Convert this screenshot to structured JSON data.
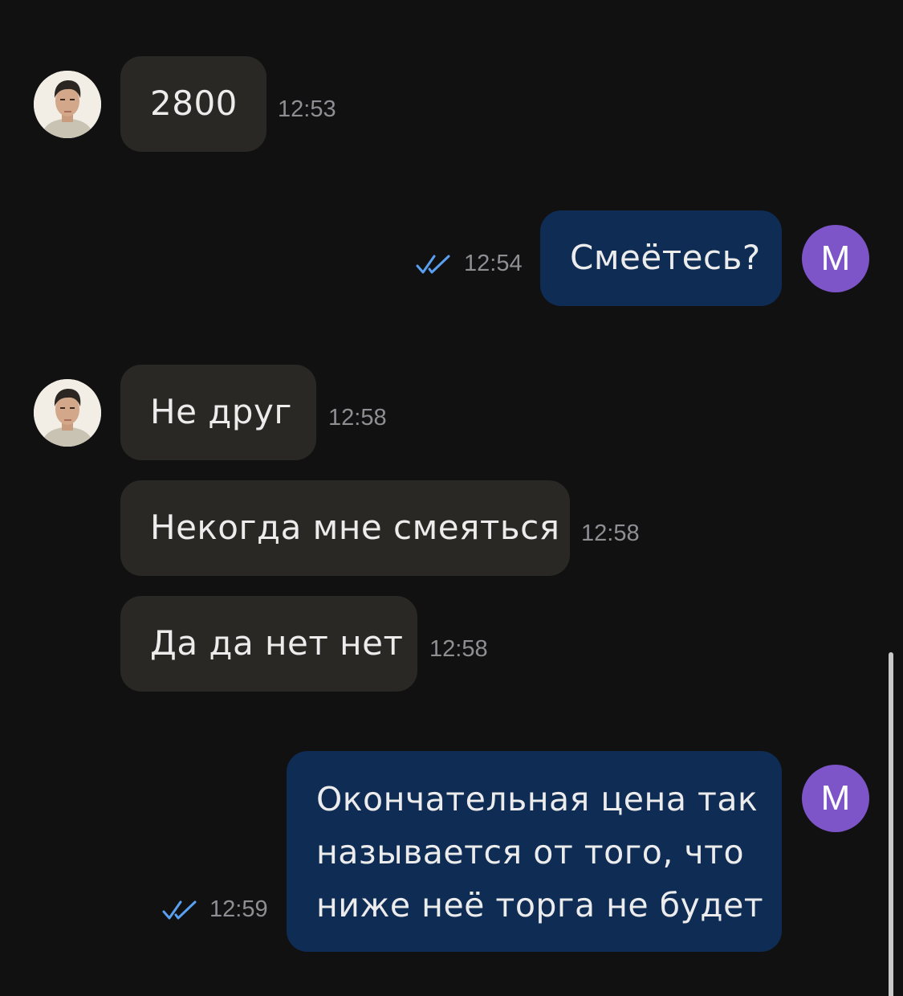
{
  "colors": {
    "background": "#111112",
    "incoming_bubble": "#2a2824",
    "outgoing_bubble": "#0f2c55",
    "read_check": "#5aa0f0",
    "own_avatar": "#7e55c8",
    "timestamp": "#8e8e93"
  },
  "contact": {
    "avatar_icon": "user-photo-avatar"
  },
  "me": {
    "avatar_letter": "M"
  },
  "messages": [
    {
      "direction": "incoming",
      "text": "2800",
      "time": "12:53"
    },
    {
      "direction": "outgoing",
      "text": "Смеётесь?",
      "time": "12:54",
      "status": "read"
    },
    {
      "direction": "incoming",
      "text": "Не друг",
      "time": "12:58"
    },
    {
      "direction": "incoming",
      "text": "Некогда мне смеяться",
      "time": "12:58"
    },
    {
      "direction": "incoming",
      "text": "Да да нет нет",
      "time": "12:58"
    },
    {
      "direction": "outgoing",
      "lines": [
        "Окончательная цена так",
        "называется от того, что",
        "ниже неё торга не будет"
      ],
      "time": "12:59",
      "status": "read"
    }
  ]
}
